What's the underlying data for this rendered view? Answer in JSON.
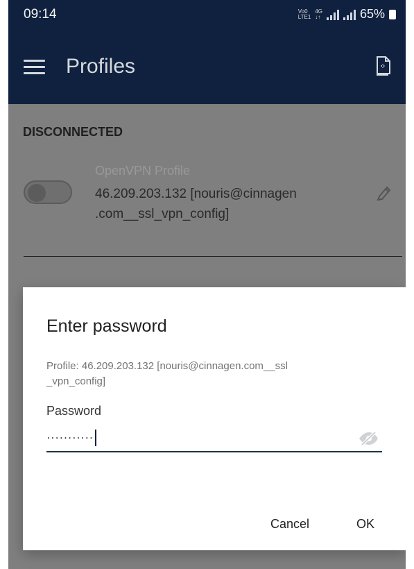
{
  "status": {
    "time": "09:14",
    "network_top": "Vo0",
    "network_bottom": "LTE1",
    "network_alt_top": "4G",
    "network_alt_bottom": "↓↑",
    "battery": "65%"
  },
  "appbar": {
    "title": "Profiles",
    "menu_icon": "hamburger-menu-icon",
    "import_icon": "import-profile-icon"
  },
  "profiles_section": {
    "status": "DISCONNECTED",
    "profile_name": "OpenVPN Profile",
    "profile_line_1": "46.209.203.132 [nouris@cinnagen",
    "profile_line_2": ".com__ssl_vpn_config]",
    "edit_icon": "pencil-icon"
  },
  "dialog": {
    "title": "Enter password",
    "profile_line_1": "Profile: 46.209.203.132 [nouris@cinnagen.com__ssl",
    "profile_line_2": "_vpn_config]",
    "field_label": "Password",
    "password_value": "···········",
    "visibility_icon": "visibility-off-icon",
    "cancel_label": "Cancel",
    "ok_label": "OK"
  },
  "colors": {
    "appbar": "#10213f",
    "overlay": "#7f7f7f",
    "accent": "#1d3345"
  }
}
